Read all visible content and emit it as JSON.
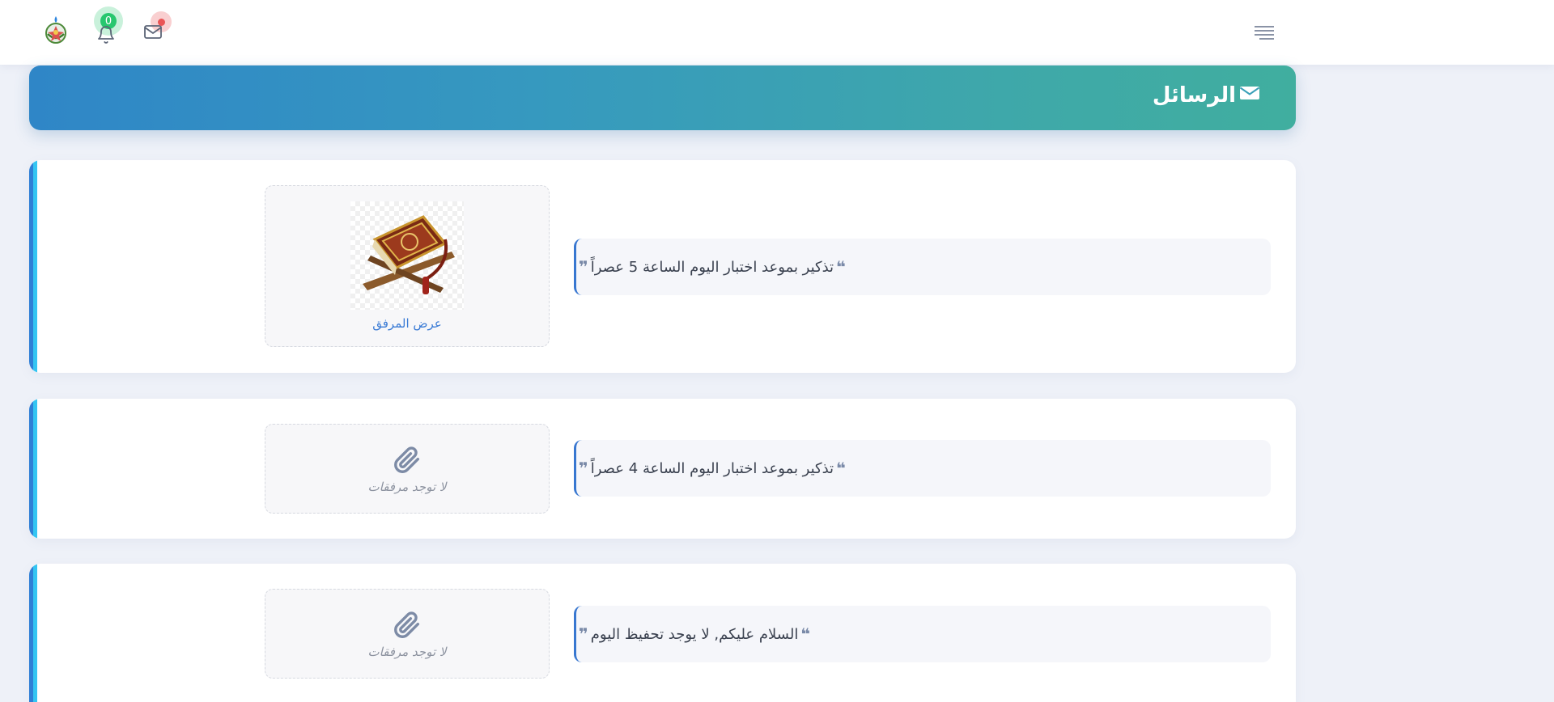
{
  "topbar": {
    "notifications_count": "0",
    "colors": {
      "badge_green": "#28c76f",
      "mail_dot_red": "#ea5455"
    }
  },
  "header": {
    "title": "الرسائل",
    "gradient": [
      "#2f86c7",
      "#40ae9f"
    ]
  },
  "messages": [
    {
      "text": "تذكير بموعد اختبار اليوم الساعة 5 عصراً",
      "attachment": {
        "has": true,
        "link_label": "عرض المرفق",
        "thumb_icon": "quran-book-on-stand"
      }
    },
    {
      "text": "تذكير بموعد اختبار اليوم الساعة 4 عصراً",
      "attachment": {
        "has": false,
        "empty_label": "لا توجد مرفقات",
        "icon": "paperclip-icon"
      }
    },
    {
      "text": "السلام عليكم, لا يوجد تحفيظ اليوم",
      "attachment": {
        "has": false,
        "empty_label": "لا توجد مرفقات",
        "icon": "paperclip-icon"
      }
    }
  ]
}
